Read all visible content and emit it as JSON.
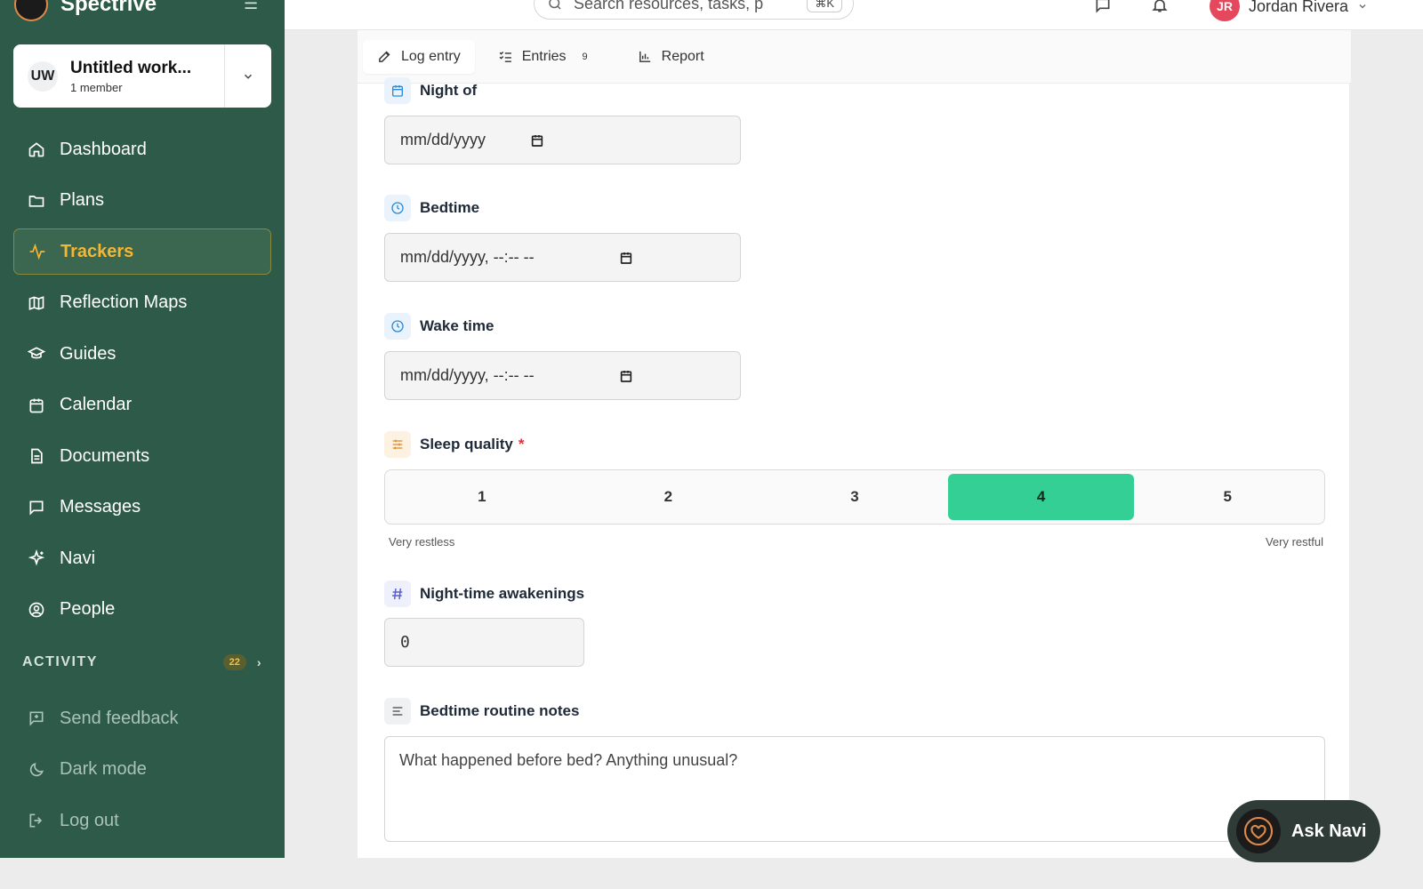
{
  "brand": {
    "name": "Spectrive"
  },
  "workspace": {
    "initials": "UW",
    "name": "Untitled work...",
    "members": "1 member"
  },
  "nav": [
    {
      "label": "Dashboard",
      "icon": "home-icon"
    },
    {
      "label": "Plans",
      "icon": "folder-icon"
    },
    {
      "label": "Trackers",
      "icon": "activity-icon",
      "active": true
    },
    {
      "label": "Reflection Maps",
      "icon": "map-icon"
    },
    {
      "label": "Guides",
      "icon": "graduation-cap-icon"
    },
    {
      "label": "Calendar",
      "icon": "calendar-icon"
    },
    {
      "label": "Documents",
      "icon": "document-icon"
    },
    {
      "label": "Messages",
      "icon": "message-icon"
    },
    {
      "label": "Navi",
      "icon": "sparkles-icon"
    },
    {
      "label": "People",
      "icon": "user-circle-icon"
    }
  ],
  "activity": {
    "label": "ACTIVITY",
    "count": "22"
  },
  "footer": [
    {
      "label": "Send feedback",
      "icon": "feedback-icon"
    },
    {
      "label": "Dark mode",
      "icon": "moon-icon"
    },
    {
      "label": "Log out",
      "icon": "logout-icon"
    }
  ],
  "topbar": {
    "search_placeholder": "Search resources, tasks, p",
    "shortcut": "⌘K",
    "user_initials": "JR",
    "user_name": "Jordan Rivera"
  },
  "tabs": [
    {
      "label": "Log entry",
      "icon": "pencil-icon",
      "active": true
    },
    {
      "label": "Entries",
      "icon": "list-check-icon",
      "count": "9"
    },
    {
      "label": "Report",
      "icon": "bar-chart-icon"
    }
  ],
  "form": {
    "night_of": {
      "label": "Night of",
      "placeholder": "mm/dd/yyyy"
    },
    "bedtime": {
      "label": "Bedtime",
      "placeholder": "mm/dd/yyyy, --:-- --"
    },
    "wake_time": {
      "label": "Wake time",
      "placeholder": "mm/dd/yyyy, --:-- --"
    },
    "sleep_quality": {
      "label": "Sleep quality",
      "required_mark": "*",
      "options": [
        "1",
        "2",
        "3",
        "4",
        "5"
      ],
      "selected": "4",
      "min_hint": "Very restless",
      "max_hint": "Very restful"
    },
    "awakenings": {
      "label": "Night-time awakenings",
      "value": "0"
    },
    "notes": {
      "label": "Bedtime routine notes",
      "placeholder": "What happened before bed? Anything unusual?"
    }
  },
  "ask_navi": {
    "label": "Ask Navi"
  },
  "colors": {
    "sidebar": "#2e5a49",
    "accent": "#f5b732",
    "selected": "#33cf95",
    "required": "#e0303f"
  }
}
